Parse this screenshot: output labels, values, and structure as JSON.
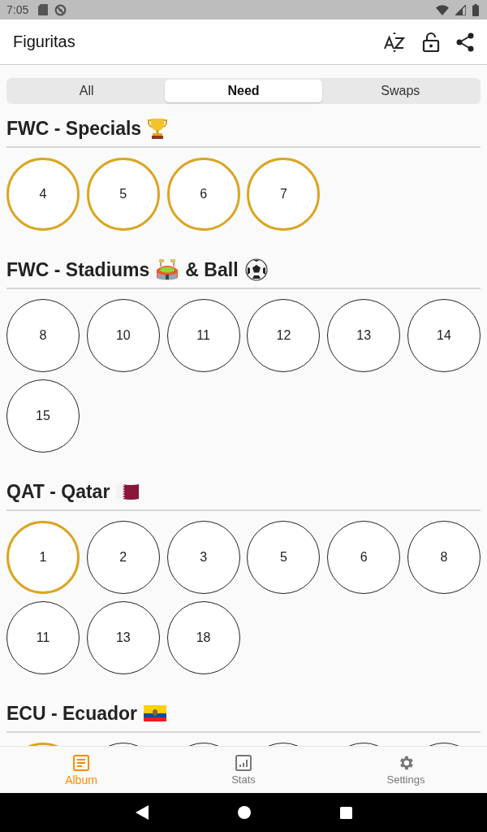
{
  "status_bar": {
    "time": "7:05"
  },
  "app_bar": {
    "title": "Figuritas"
  },
  "tabs": [
    {
      "label": "All",
      "selected": false
    },
    {
      "label": "Need",
      "selected": true
    },
    {
      "label": "Swaps",
      "selected": false
    }
  ],
  "sections": [
    {
      "title_parts": [
        {
          "kind": "text",
          "text": "FWC - Specials"
        },
        {
          "kind": "trophy"
        }
      ],
      "stickers": [
        {
          "number": "4",
          "special": true
        },
        {
          "number": "5",
          "special": true
        },
        {
          "number": "6",
          "special": true
        },
        {
          "number": "7",
          "special": true
        }
      ]
    },
    {
      "title_parts": [
        {
          "kind": "text",
          "text": "FWC - Stadiums"
        },
        {
          "kind": "stadium"
        },
        {
          "kind": "text",
          "text": "& Ball"
        },
        {
          "kind": "ball"
        }
      ],
      "stickers": [
        {
          "number": "8",
          "special": false
        },
        {
          "number": "10",
          "special": false
        },
        {
          "number": "11",
          "special": false
        },
        {
          "number": "12",
          "special": false
        },
        {
          "number": "13",
          "special": false
        },
        {
          "number": "14",
          "special": false
        },
        {
          "number": "15",
          "special": false
        }
      ]
    },
    {
      "title_parts": [
        {
          "kind": "text",
          "text": "QAT - Qatar"
        },
        {
          "kind": "flag-qatar"
        }
      ],
      "stickers": [
        {
          "number": "1",
          "special": true
        },
        {
          "number": "2",
          "special": false
        },
        {
          "number": "3",
          "special": false
        },
        {
          "number": "5",
          "special": false
        },
        {
          "number": "6",
          "special": false
        },
        {
          "number": "8",
          "special": false
        },
        {
          "number": "11",
          "special": false
        },
        {
          "number": "13",
          "special": false
        },
        {
          "number": "18",
          "special": false
        }
      ]
    },
    {
      "title_parts": [
        {
          "kind": "text",
          "text": "ECU - Ecuador"
        },
        {
          "kind": "flag-ecuador"
        }
      ],
      "stickers": [
        {
          "special": true
        },
        {
          "special": false
        },
        {
          "special": false
        },
        {
          "special": false
        },
        {
          "special": false
        },
        {
          "special": false
        }
      ]
    }
  ],
  "bottom_nav": [
    {
      "label": "Album",
      "selected": true
    },
    {
      "label": "Stats",
      "selected": false
    },
    {
      "label": "Settings",
      "selected": false
    }
  ]
}
